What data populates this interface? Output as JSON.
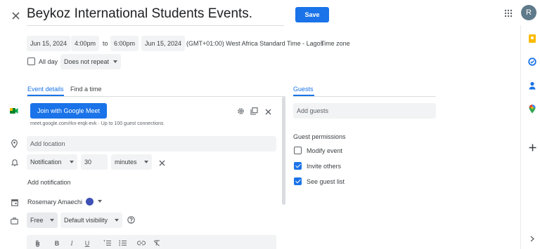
{
  "header": {
    "title": "Beykoz International Students Events.",
    "save_label": "Save",
    "avatar_initial": "R"
  },
  "datetime": {
    "start_date": "Jun 15, 2024",
    "start_time": "4:00pm",
    "to_label": "to",
    "end_time": "6:00pm",
    "end_date": "Jun 15, 2024",
    "timezone": "(GMT+01:00) West Africa Standard Time - Lagos",
    "timezone_link": "Time zone",
    "all_day_label": "All day",
    "repeat": "Does not repeat"
  },
  "tabs": {
    "event_details": "Event details",
    "find_time": "Find a time",
    "guests": "Guests"
  },
  "meet": {
    "button_label": "Join with Google Meet",
    "info": "meet.google.com/rkn-erqk-evk · Up to 100 guest connections"
  },
  "location": {
    "placeholder": "Add location"
  },
  "notification": {
    "type": "Notification",
    "value": "30",
    "unit": "minutes",
    "add_label": "Add notification"
  },
  "calendar": {
    "owner": "Rosemary Amaechi",
    "color": "#3f51b5"
  },
  "availability": {
    "status": "Free",
    "visibility": "Default visibility"
  },
  "guests": {
    "placeholder": "Add guests",
    "permissions_title": "Guest permissions",
    "permissions": [
      {
        "label": "Modify event",
        "checked": false
      },
      {
        "label": "Invite others",
        "checked": true
      },
      {
        "label": "See guest list",
        "checked": true
      }
    ]
  },
  "colors": {
    "accent": "#1a73e8",
    "field_bg": "#f1f3f4"
  }
}
